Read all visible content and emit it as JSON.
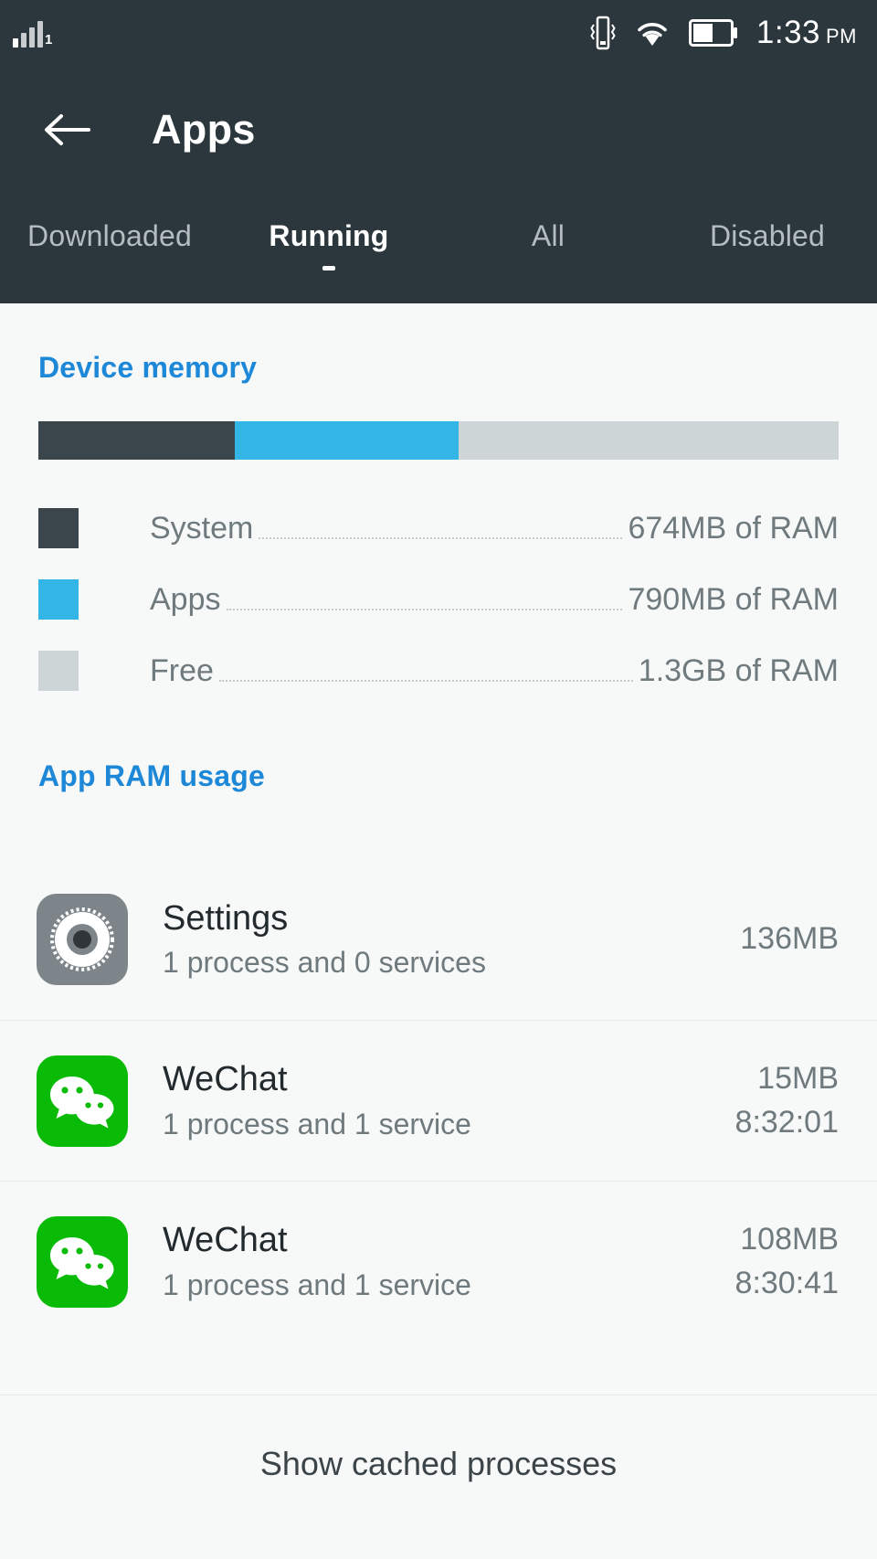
{
  "status_bar": {
    "signal_icon": "signal-bars-icon",
    "sim_index": "1",
    "vibrate_icon": "vibrate-icon",
    "wifi_icon": "wifi-icon",
    "battery_icon": "battery-half-icon",
    "time": "1:33",
    "am_pm": "PM"
  },
  "app_bar": {
    "back_icon": "back-arrow-icon",
    "title": "Apps"
  },
  "tabs": [
    {
      "label": "Downloaded",
      "active": false
    },
    {
      "label": "Running",
      "active": true
    },
    {
      "label": "All",
      "active": false
    },
    {
      "label": "Disabled",
      "active": false
    }
  ],
  "device_memory": {
    "title": "Device memory",
    "bar_segments": [
      {
        "name": "System",
        "color": "#3a464b",
        "percent": 24.5
      },
      {
        "name": "Apps",
        "color": "#33b5e5",
        "percent": 28.0
      },
      {
        "name": "Free",
        "color": "#cdd5d7",
        "percent": 47.5
      }
    ],
    "legend": [
      {
        "label": "System",
        "value": "674MB of RAM",
        "color": "#3a464b"
      },
      {
        "label": "Apps",
        "value": "790MB of RAM",
        "color": "#33b5e5"
      },
      {
        "label": "Free",
        "value": "1.3GB of RAM",
        "color": "#cdd5d7"
      }
    ]
  },
  "app_ram_usage": {
    "title": "App RAM usage",
    "rows": [
      {
        "icon": "settings-gear-icon",
        "name": "Settings",
        "subtitle": "1 process and 0 services",
        "memory": "136MB",
        "time": ""
      },
      {
        "icon": "wechat-icon",
        "name": "WeChat",
        "subtitle": "1 process and 1 service",
        "memory": "15MB",
        "time": "8:32:01"
      },
      {
        "icon": "wechat-icon",
        "name": "WeChat",
        "subtitle": "1 process and 1 service",
        "memory": "108MB",
        "time": "8:30:41"
      }
    ]
  },
  "footer": {
    "label": "Show cached processes"
  },
  "colors": {
    "app_bar_bg": "#2b373c",
    "accent_blue": "#1e88d8",
    "system_color": "#3a464b",
    "apps_color": "#33b5e5",
    "free_color": "#cdd5d7",
    "wechat_green": "#09bb07",
    "settings_gray": "#7d858a"
  }
}
